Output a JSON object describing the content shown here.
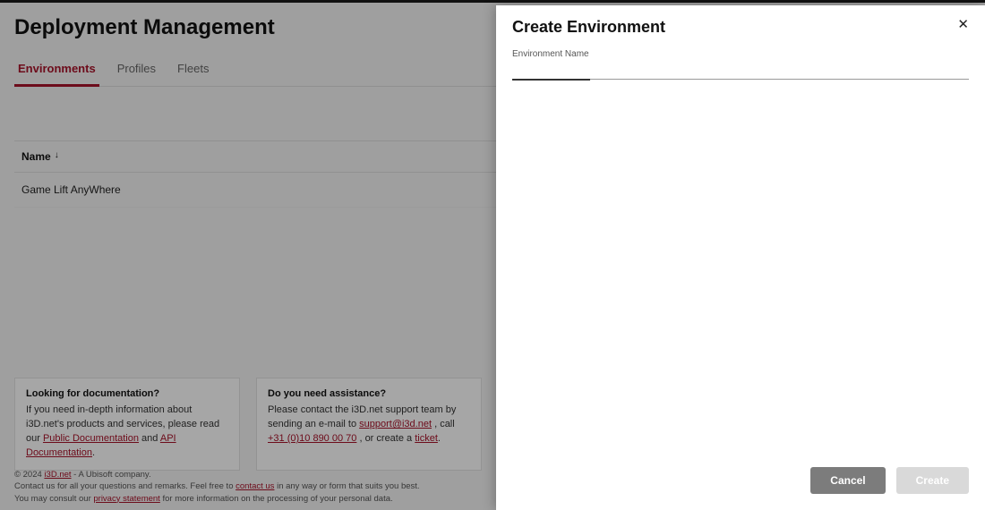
{
  "page": {
    "title": "Deployment Management"
  },
  "tabs": {
    "items": [
      {
        "label": "Environments",
        "active": true
      },
      {
        "label": "Profiles",
        "active": false
      },
      {
        "label": "Fleets",
        "active": false
      }
    ]
  },
  "table": {
    "column_header": "Name",
    "rows": [
      {
        "name": "Game Lift AnyWhere"
      }
    ]
  },
  "cards": {
    "doc": {
      "title": "Looking for documentation?",
      "body_prefix": "If you need in-depth information about i3D.net's products and services, please read our ",
      "link1": "Public Documentation",
      "mid": " and ",
      "link2": "API Documentation",
      "suffix": "."
    },
    "assist": {
      "title": "Do you need assistance?",
      "body_prefix": "Please contact the i3D.net support team by sending an e-mail to ",
      "email": "support@i3d.net",
      "mid1": ", call ",
      "phone": "+31 (0)10 890 00 70",
      "mid2": ", or create a ",
      "ticket": "ticket",
      "suffix": "."
    }
  },
  "footer": {
    "line1_prefix": "© 2024 ",
    "line1_link": "i3D.net",
    "line1_suffix": " - A Ubisoft company.",
    "line2_prefix": "Contact us for all your questions and remarks. Feel free to ",
    "line2_link": "contact us",
    "line2_suffix": " in any way or form that suits you best.",
    "line3_prefix": "You may consult our ",
    "line3_link": "privacy statement",
    "line3_suffix": " for more information on the processing of your personal data."
  },
  "drawer": {
    "title": "Create Environment",
    "field_label": "Environment Name",
    "field_value": "",
    "cancel": "Cancel",
    "create": "Create"
  }
}
